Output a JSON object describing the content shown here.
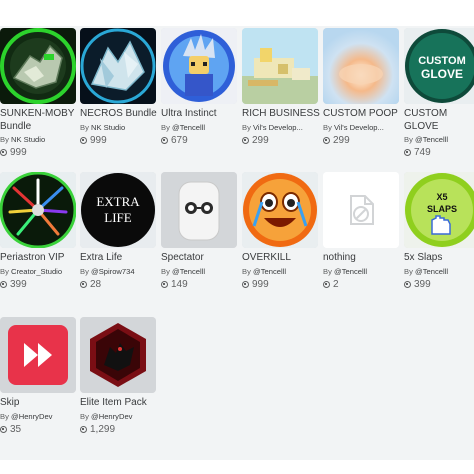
{
  "items": [
    {
      "name": "SUNKEN-MOBY Bundle",
      "by": "By",
      "creator": "NK Studio",
      "price": "999",
      "icon": "sunken-moby-thumbnail"
    },
    {
      "name": "NECROS Bundle",
      "by": "By",
      "creator": "NK Studio",
      "price": "999",
      "icon": "necros-thumbnail"
    },
    {
      "name": "Ultra Instinct",
      "by": "By",
      "creator": "@Tencelll",
      "price": "679",
      "icon": "ultra-instinct-thumbnail"
    },
    {
      "name": "RICH BUSINESS",
      "by": "By",
      "creator": "Vil's Develop...",
      "price": "299",
      "icon": "rich-business-thumbnail"
    },
    {
      "name": "CUSTOM POOP",
      "by": "By",
      "creator": "Vil's Develop...",
      "price": "299",
      "icon": "custom-poop-thumbnail"
    },
    {
      "name": "CUSTOM GLOVE",
      "by": "By",
      "creator": "@Tencelll",
      "price": "749",
      "icon": "custom-glove-thumbnail",
      "thumb_text": "CUSTOM GLOVE"
    },
    {
      "name": "Periastron VIP",
      "by": "By",
      "creator": "Creator_Studio",
      "price": "399",
      "icon": "periastron-thumbnail"
    },
    {
      "name": "Extra Life",
      "by": "By",
      "creator": "@Spirow734",
      "price": "28",
      "icon": "extra-life-thumbnail",
      "thumb_text": "EXTRA LIFE"
    },
    {
      "name": "Spectator",
      "by": "By",
      "creator": "@Tencelll",
      "price": "149",
      "icon": "spectator-thumbnail"
    },
    {
      "name": "OVERKILL",
      "by": "By",
      "creator": "@Tencelll",
      "price": "999",
      "icon": "overkill-thumbnail"
    },
    {
      "name": "nothing",
      "by": "By",
      "creator": "@Tencelll",
      "price": "2",
      "icon": "broken-image-icon"
    },
    {
      "name": "5x Slaps",
      "by": "By",
      "creator": "@Tencelll",
      "price": "399",
      "icon": "5x-slaps-thumbnail",
      "thumb_text": "X5 SLAPS"
    },
    {
      "name": "Skip",
      "by": "By",
      "creator": "@HenryDev",
      "price": "35",
      "icon": "skip-thumbnail"
    },
    {
      "name": "Elite Item Pack",
      "by": "By",
      "creator": "@HenryDev",
      "price": "1,299",
      "icon": "elite-item-pack-thumbnail"
    }
  ],
  "colors": {
    "panel_bg": "#f2f4f5",
    "text_primary": "#393b3d",
    "text_secondary": "#606162",
    "skip_red": "#e8334a",
    "overkill_orange": "#f08a1c",
    "slaps_green": "#9fd42a"
  }
}
